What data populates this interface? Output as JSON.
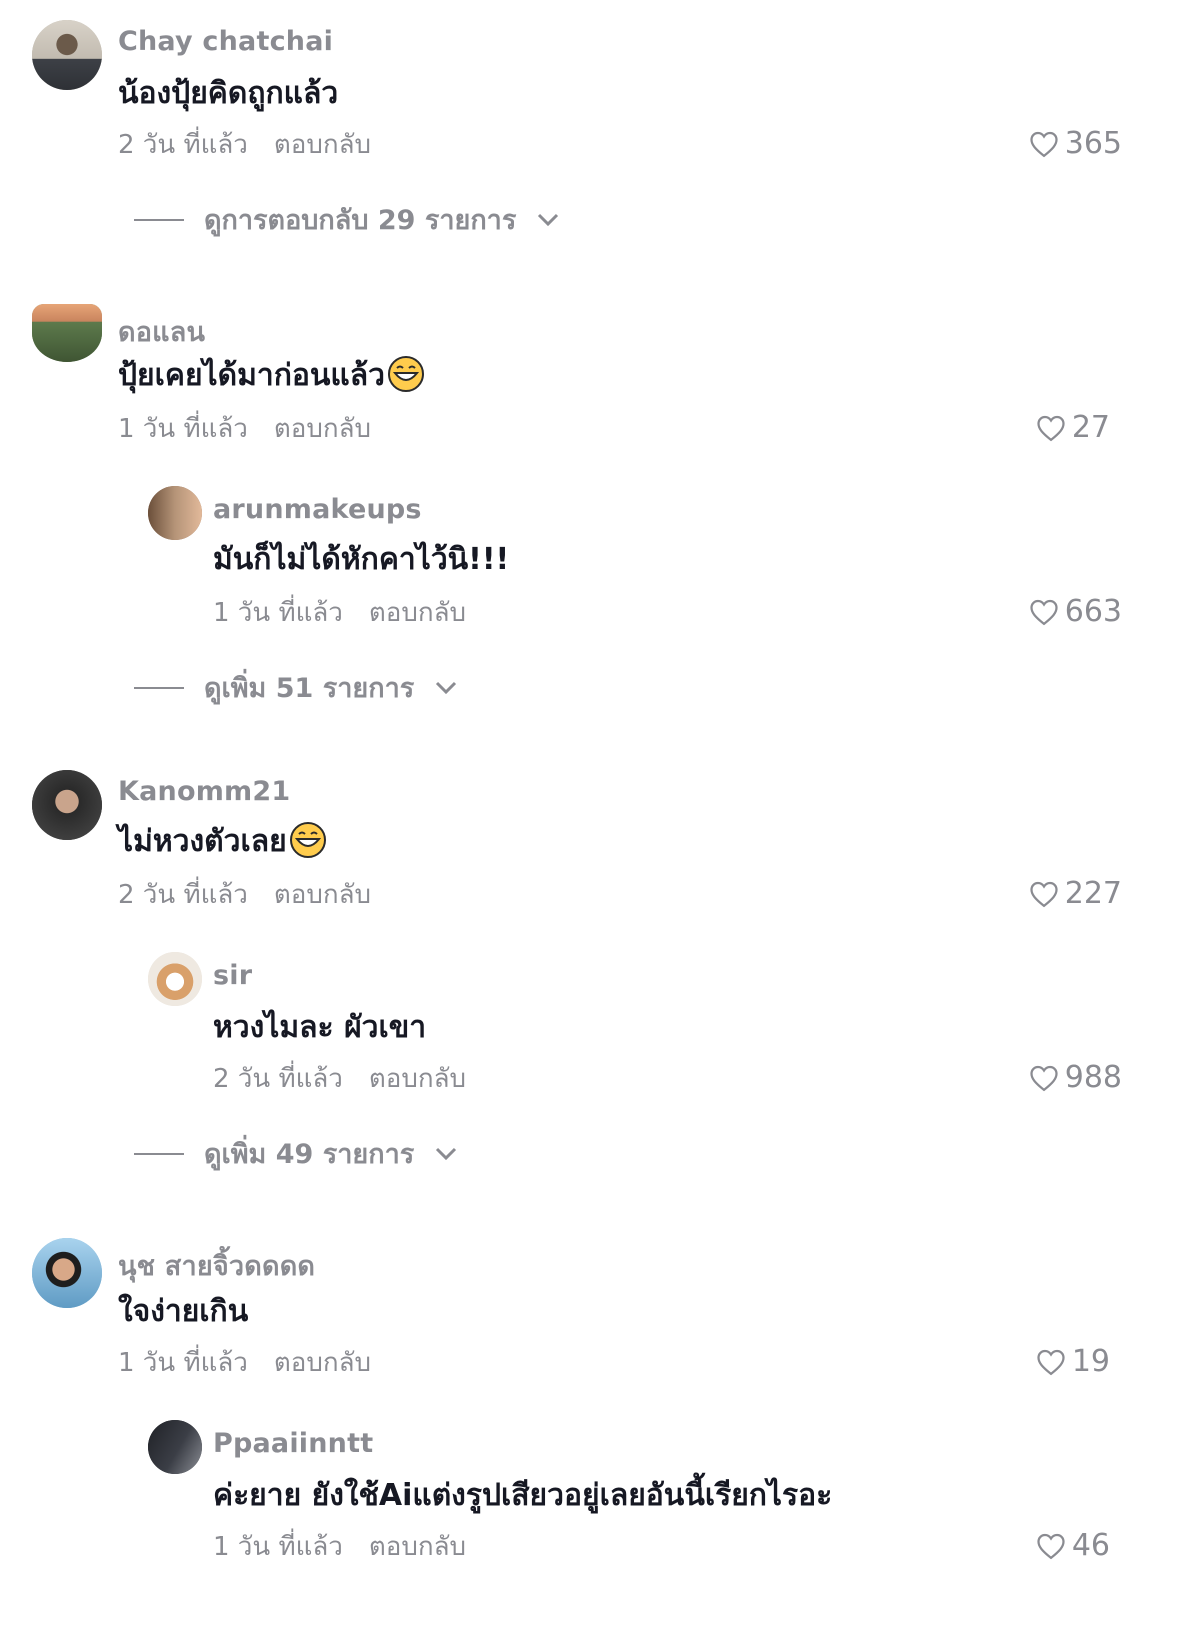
{
  "reply_label": "ตอบกลับ",
  "comments": [
    {
      "username": "Chay chatchai",
      "text": "น้องปุ้ยคิดถูกแล้ว",
      "time": "2 วัน ที่แล้ว",
      "likes": "365",
      "view_more": "ดูการตอบกลับ 29 รายการ"
    },
    {
      "username": "ดอแลน",
      "text": "ปุ้ยเคยได้มาก่อนแล้ว",
      "emoji": "grinning-sweat-emoji",
      "time": "1 วัน ที่แล้ว",
      "likes": "27",
      "reply": {
        "username": "arunmakeups",
        "text": "มันก็ไม่ได้หักคาไว้นิ!!!",
        "time": "1 วัน ที่แล้ว",
        "likes": "663"
      },
      "view_more": "ดูเพิ่ม 51 รายการ"
    },
    {
      "username": "Kanomm21",
      "text": "ไม่หวงตัวเลย",
      "emoji": "grinning-sweat-emoji",
      "time": "2 วัน ที่แล้ว",
      "likes": "227",
      "reply": {
        "username": "sir",
        "text": "หวงไมละ ผัวเขา",
        "time": "2 วัน ที่แล้ว",
        "likes": "988"
      },
      "view_more": "ดูเพิ่ม 49 รายการ"
    },
    {
      "username": "นุช สายจิ้วดดดด",
      "text": "ใจง่ายเกิน",
      "time": "1 วัน ที่แล้ว",
      "likes": "19",
      "reply": {
        "username": "Ppaaiinntt",
        "text": "ค่ะยาย ยังใช้Aiแต่งรูปเสียวอยู่เลยอันนี้เรียกไรอะ",
        "time": "1 วัน ที่แล้ว",
        "likes": "46"
      }
    }
  ]
}
